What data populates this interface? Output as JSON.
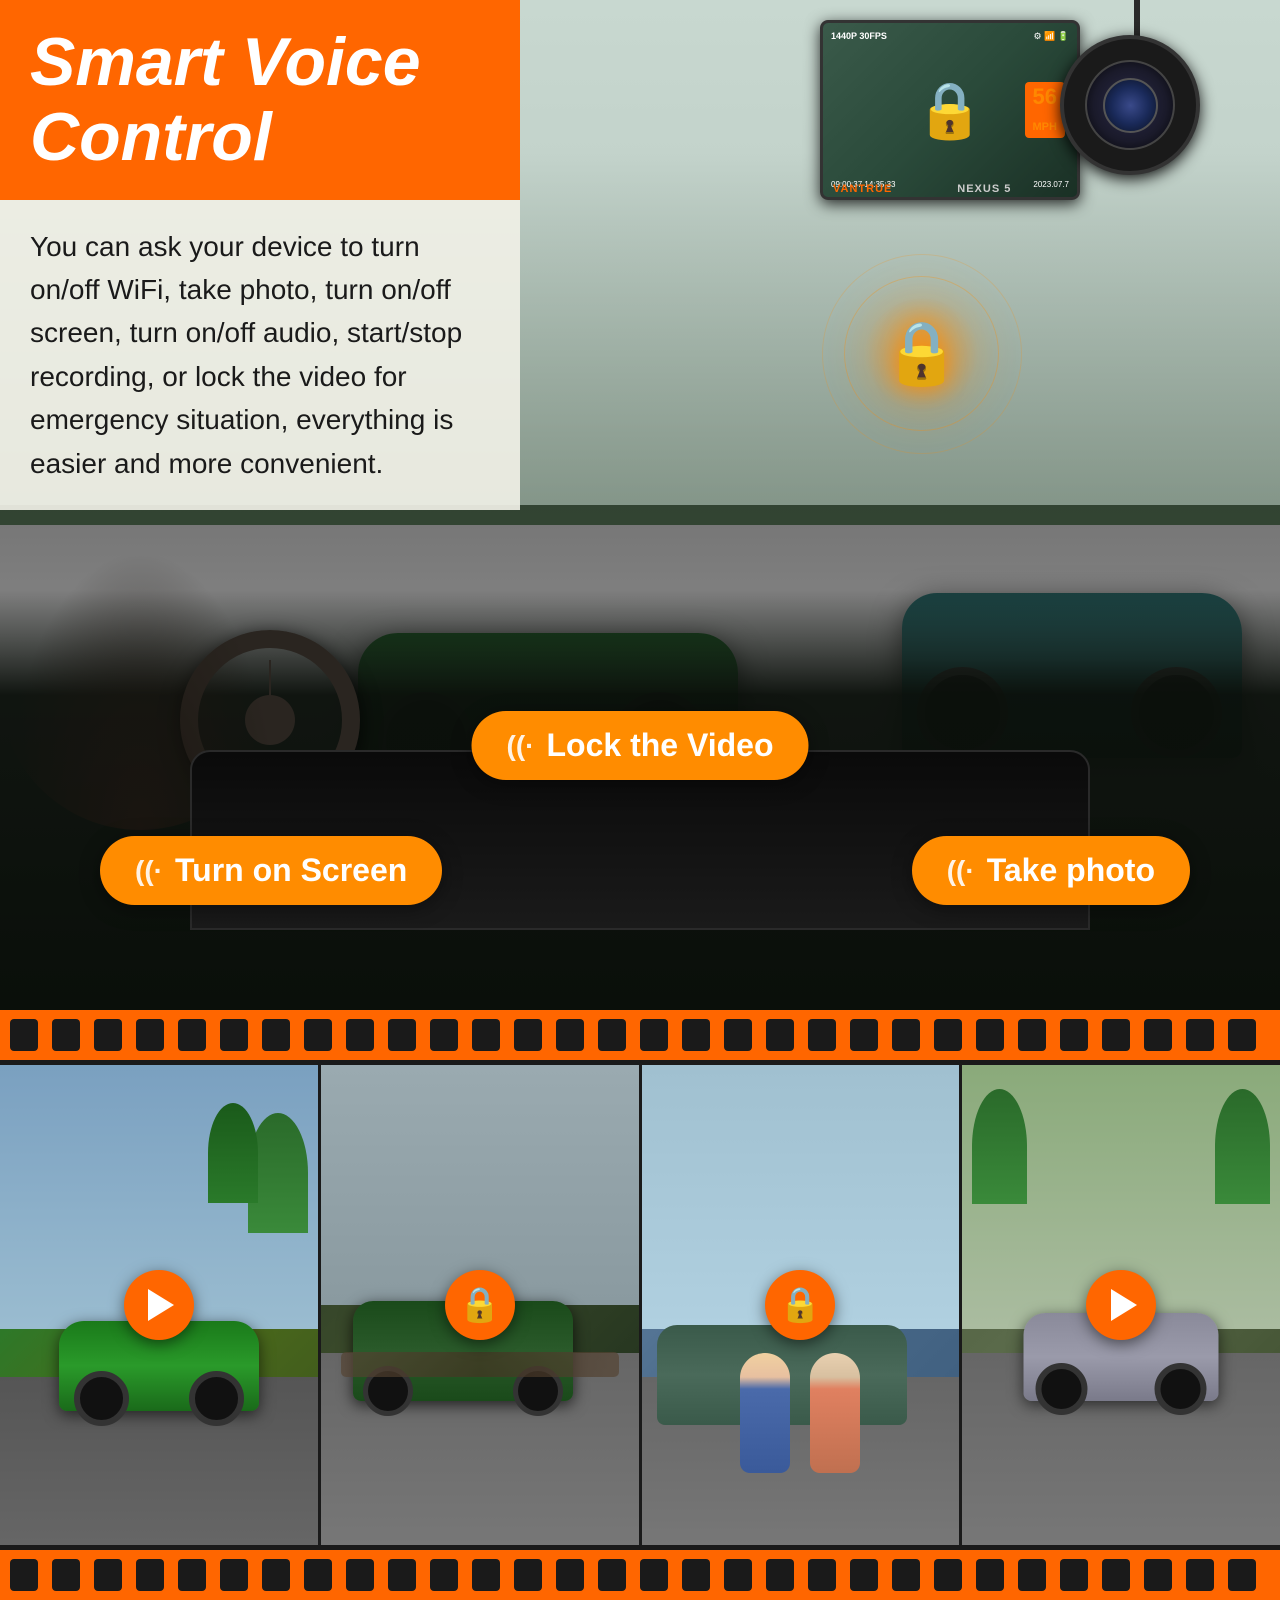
{
  "page": {
    "title": "Smart Voice Control",
    "title_line2": "Control",
    "description": "You can ask your device to turn on/off WiFi, take photo, turn on/off screen, turn on/off audio, start/stop recording, or lock the video for emergency situation, everything is easier and more convenient.",
    "voice_commands": {
      "lock_video": "Lock the Video",
      "turn_on_screen": "Turn on Screen",
      "take_photo": "Take photo"
    },
    "dashcam": {
      "brand": "VANTRUE",
      "model": "NEXUS 5",
      "resolution": "1440P 30FPS",
      "speed": "56",
      "speed_unit": "MPH",
      "date": "2023.07.7",
      "time": "09:00:37  14:35:33"
    },
    "colors": {
      "orange": "#ff6600",
      "orange_light": "#ff8c00",
      "dark_bg": "#1a1a1a",
      "text_dark": "#1a1a1a",
      "text_white": "#ffffff"
    },
    "thumbnails": [
      {
        "id": 1,
        "type": "play",
        "description": "Green sports car on road"
      },
      {
        "id": 2,
        "type": "lock",
        "description": "Green car crash scene"
      },
      {
        "id": 3,
        "type": "lock",
        "description": "Two people at car"
      },
      {
        "id": 4,
        "type": "play",
        "description": "Gray car on road"
      }
    ]
  }
}
